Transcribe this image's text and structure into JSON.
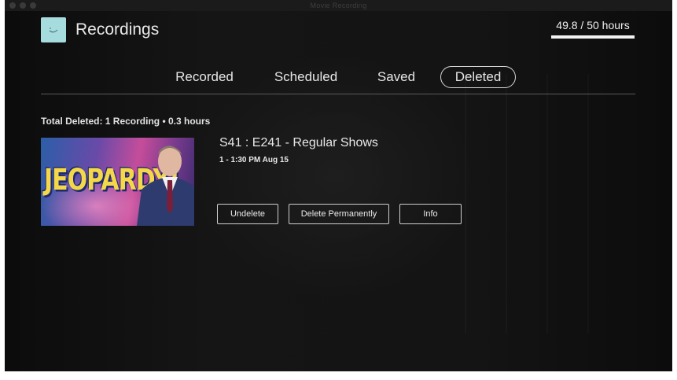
{
  "window": {
    "title": "Movie Recording"
  },
  "header": {
    "title": "Recordings",
    "usage_text": "49.8 / 50 hours",
    "usage_fraction": 0.996
  },
  "tabs": [
    {
      "label": "Recorded",
      "active": false
    },
    {
      "label": "Scheduled",
      "active": false
    },
    {
      "label": "Saved",
      "active": false
    },
    {
      "label": "Deleted",
      "active": true
    }
  ],
  "summary": "Total Deleted: 1 Recording • 0.3 hours",
  "recordings": [
    {
      "thumbnail_text": "JEOPARDY!",
      "title": "S41 : E241 - Regular Shows",
      "time": "1 - 1:30 PM Aug 15",
      "actions": {
        "undelete": "Undelete",
        "delete_permanently": "Delete Permanently",
        "info": "Info"
      }
    }
  ],
  "colors": {
    "logo_bg": "#a7dcdf",
    "background": "#0d0d0d",
    "text": "#e8e8e8"
  }
}
